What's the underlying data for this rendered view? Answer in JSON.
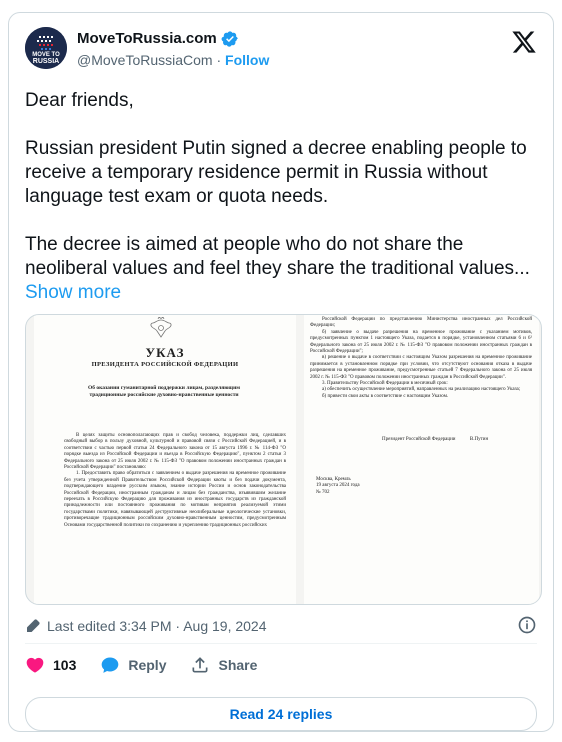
{
  "author": {
    "display_name": "MoveToRussia.com",
    "handle": "@MoveToRussiaCom",
    "separator": " · ",
    "follow_label": "Follow",
    "avatar_text_line1": "MOVE TO",
    "avatar_text_line2": "RUSSIA"
  },
  "tweet": {
    "paragraphs": [
      "Dear friends,",
      "Russian president Putin signed a decree enabling people to receive a temporary residence permit in Russia without language test exam or quota needs.",
      "The decree is aimed at people who do not share the neoliberal values and feel they share the traditional values..."
    ],
    "show_more": "Show more"
  },
  "document": {
    "heading": "УКАЗ",
    "subheading": "ПРЕЗИДЕНТА РОССИЙСКОЙ ФЕДЕРАЦИИ",
    "title": "Об оказании гуманитарной поддержки лицам, разделяющим традиционные российские духовно-нравственные ценности",
    "left_body": [
      "В целях защиты основополагающих прав и свобод человека, поддержки лиц, сделавших свободный выбор в пользу духовной, культурной и правовой связи с Российской Федерацией, и в соответствии с частью первой статьи 24 Федерального закона от 15 августа 1996 г. № 114-ФЗ \"О порядке выезда из Российской Федерации и въезда в Российскую Федерацию\", пунктом 2 статьи 3 Федерального закона от 25 июля 2002 г. № 115-ФЗ \"О правовом положении иностранных граждан в Российской Федерации\" постановляю:",
      "1. Предоставить право обратиться с заявлением о выдаче разрешения на временное проживание без учета утвержденной Правительством Российской Федерации квоты и без подачи документа, подтверждающего владение русским языком, знание истории России и основ законодательства Российской Федерации, иностранным гражданам и лицам без гражданства, изъявившим желание переехать в Российскую Федерацию для проживания из иностранных государств из гражданской принадлежности или постоянного проживания по мотивам неприятия реализуемой этими государствами политики, навязывающей деструктивные неолиберальные идеологические установки, противоречащие традиционным российским духовно-нравственным ценностям, предусмотренным Основами государственной политики по сохранению и укреплению традиционных российских"
    ],
    "right_body": [
      "Российской Федерации по представлению Министерства иностранных дел Российской Федерации;",
      "б) заявление о выдаче разрешения на временное проживание с указанием мотивов, предусмотренных пунктом 1 настоящего Указа, подается в порядке, установленном статьями 6 и 6¹ Федерального закона от 25 июля 2002 г. № 115-ФЗ \"О правовом положении иностранных граждан в Российской Федерации\";",
      "в) решение о выдаче в соответствии с настоящим Указом разрешения на временное проживание принимается в установленном порядке при условии, что отсутствуют основания отказа в выдаче разрешения на временное проживание, предусмотренные статьей 7 Федерального закона от 25 июля 2002 г. № 115-ФЗ \"О правовом положении иностранных граждан в Российской Федерации\".",
      "3. Правительству Российской Федерации в месячный срок:",
      "а) обеспечить осуществление мероприятий, направленных на реализацию настоящего Указа;",
      "б) привести свои акты в соответствие с настоящим Указом."
    ],
    "signature_left": "Президент Российской Федерации",
    "signature_right": "В.Путин",
    "place": "Москва, Кремль",
    "date": "19 августа 2024 года",
    "number": "№ 702"
  },
  "meta": {
    "edited_text": "Last edited 3:34 PM · Aug 19, 2024"
  },
  "actions": {
    "likes": "103",
    "reply_label": "Reply",
    "share_label": "Share"
  },
  "replies_button": "Read 24 replies",
  "colors": {
    "link": "#1d9bf0",
    "like": "#f91880",
    "reply": "#1d9bf0",
    "secondary": "#536471"
  }
}
